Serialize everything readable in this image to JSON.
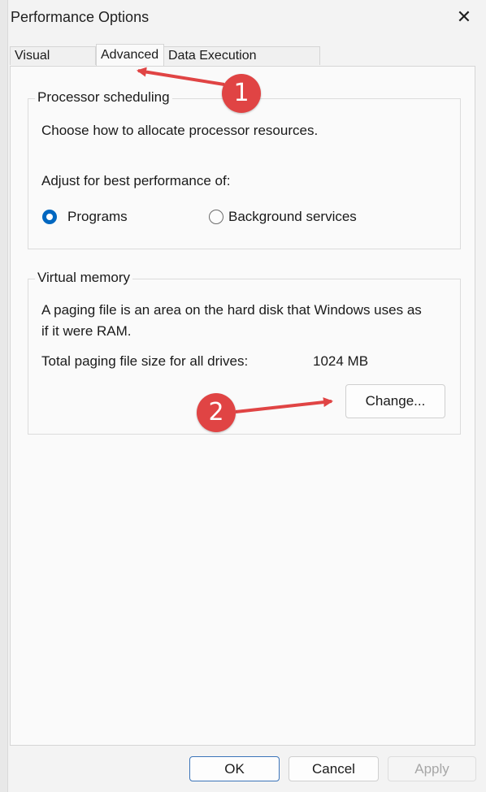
{
  "window": {
    "title": "Performance Options",
    "close_icon": "close-icon"
  },
  "tabs": [
    {
      "label": "Visual Effects",
      "active": false
    },
    {
      "label": "Advanced",
      "active": true
    },
    {
      "label": "Data Execution Prevention",
      "active": false
    }
  ],
  "processor_scheduling": {
    "legend": "Processor scheduling",
    "description": "Choose how to allocate processor resources.",
    "adjust_label": "Adjust for best performance of:",
    "options": [
      {
        "label": "Programs",
        "selected": true
      },
      {
        "label": "Background services",
        "selected": false
      }
    ]
  },
  "virtual_memory": {
    "legend": "Virtual memory",
    "description_line1": "A paging file is an area on the hard disk that Windows uses as",
    "description_line2": "if it were RAM.",
    "total_label": "Total paging file size for all drives:",
    "total_value": "1024 MB",
    "change_button": "Change..."
  },
  "footer": {
    "ok": "OK",
    "cancel": "Cancel",
    "apply": "Apply"
  },
  "annotations": [
    {
      "number": "1",
      "color": "#e04444"
    },
    {
      "number": "2",
      "color": "#e04444"
    }
  ],
  "accent_color": "#0067c0"
}
